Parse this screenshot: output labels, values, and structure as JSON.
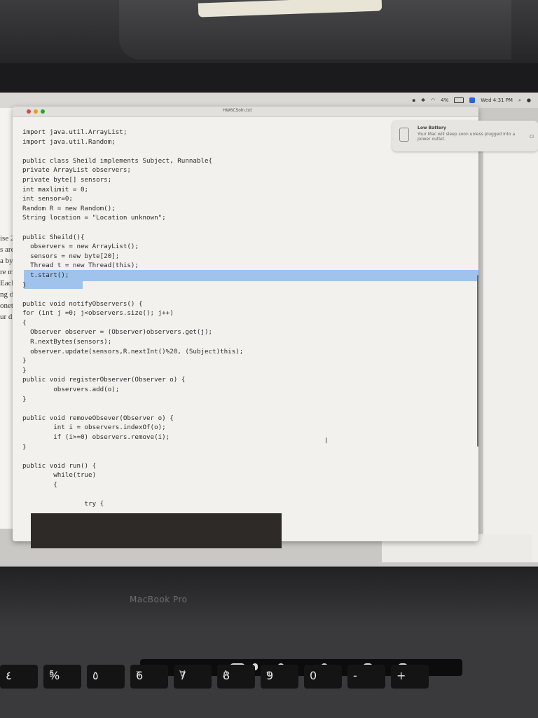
{
  "menubar": {
    "clock": "Wed 4:31 PM",
    "battery_percent": "4%"
  },
  "window": {
    "title": "HW6CSoln.txt"
  },
  "notification": {
    "title": "Low Battery",
    "body": "Your Mac will sleep soon unless plugged into a power outlet.",
    "action": "Cl"
  },
  "background_doc": {
    "fragments": [
      "ise 2",
      "s are",
      "a byt",
      "re m",
      "Each",
      "ng d",
      "onet",
      "ur d"
    ]
  },
  "code_lines": [
    "import java.util.ArrayList;",
    "import java.util.Random;",
    "",
    "public class Sheild implements Subject, Runnable{",
    "private ArrayList observers;",
    "private byte[] sensors;",
    "int maxlimit = 0;",
    "int sensor=0;",
    "Random R = new Random();",
    "String location = \"Location unknown\";",
    "",
    "public Sheild(){",
    "  observers = new ArrayList();",
    "  sensors = new byte[20];",
    "  Thread t = new Thread(this);",
    "  t.start();",
    "}",
    "",
    "public void notifyObservers() {",
    "for (int j =0; j<observers.size(); j++)",
    "{",
    "  Observer observer = (Observer)observers.get(j);",
    "  R.nextBytes(sensors);",
    "  observer.update(sensors,R.nextInt()%20, (Subject)this);",
    "}",
    "}",
    "public void registerObserver(Observer o) {",
    "        observers.add(o);",
    "}",
    "",
    "public void removeObsever(Observer o) {",
    "        int i = observers.indexOf(o);",
    "        if (i>=0) observers.remove(i);",
    "}",
    "",
    "public void run() {",
    "        while(true)",
    "        {",
    "",
    "                try {"
  ],
  "dock": {
    "icons": [
      "notes-icon",
      "reminders-icon",
      "maps-icon",
      "photos-icon",
      "messages-icon",
      "facetime-icon",
      "pages-icon",
      "keynote-icon",
      "music-icon",
      "app-store-icon",
      "system-preferences-icon",
      "chrome-icon",
      "archive-icon",
      "word-icon",
      "textedit-icon",
      "vscode-icon",
      "preview-icon",
      "documents-folder-icon",
      "trash-icon"
    ]
  },
  "device": {
    "brand_label": "MacBook Pro"
  },
  "keyboard": {
    "keys": [
      {
        "main": "٤",
        "alt": ""
      },
      {
        "main": "%",
        "alt": "5"
      },
      {
        "main": "٥",
        "alt": ""
      },
      {
        "main": "6",
        "alt": "٦"
      },
      {
        "main": "7",
        "alt": "V"
      },
      {
        "main": "8",
        "alt": "Λ"
      },
      {
        "main": "9",
        "alt": "٩"
      },
      {
        "main": "0",
        "alt": "."
      },
      {
        "main": "-",
        "alt": ""
      },
      {
        "main": "+",
        "alt": ""
      }
    ]
  },
  "colors": {
    "selection": "#9fc3ec",
    "editor_bg": "#f2f1ee",
    "dock_bg": "#c8aa96"
  }
}
